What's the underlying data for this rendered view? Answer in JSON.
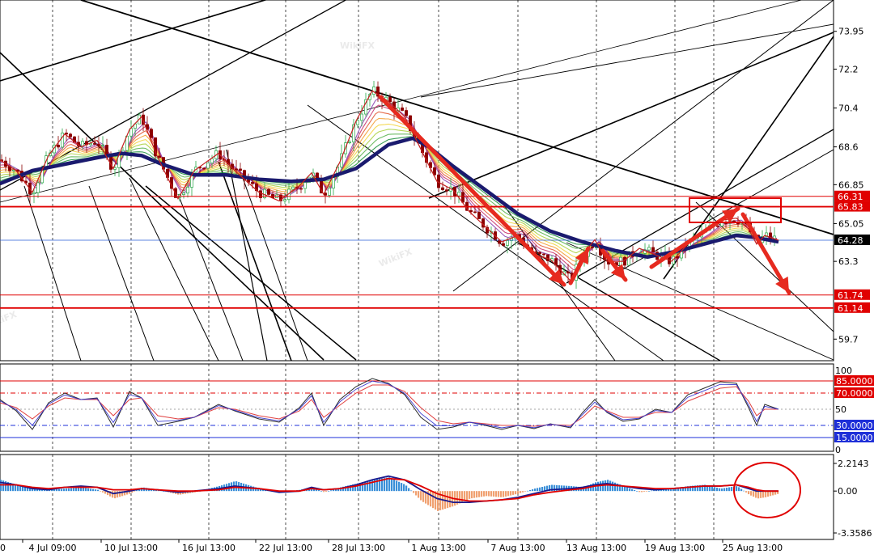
{
  "chart_data": [
    {
      "type": "line",
      "panel": "price",
      "title": "",
      "y_axis_ticks": [
        73.95,
        72.2,
        70.4,
        68.6,
        66.85,
        65.05,
        63.3,
        59.7
      ],
      "ylim": [
        58.7,
        75.4
      ],
      "x_axis_ticks": [
        "4 Jul 09:00",
        "10 Jul 13:00",
        "16 Jul 13:00",
        "22 Jul 13:00",
        "28 Jul 13:00",
        "1 Aug 13:00",
        "7 Aug 13:00",
        "13 Aug 13:00",
        "19 Aug 13:00",
        "25 Aug 13:00"
      ],
      "x_edge_label": "0",
      "current_price": {
        "value": 64.28,
        "label": "64.28",
        "color": "#000000"
      },
      "horizontal_levels": [
        {
          "value": 66.31,
          "label": "66.31",
          "color": "#e00000"
        },
        {
          "value": 65.83,
          "label": "65.83",
          "color": "#e00000"
        },
        {
          "value": 61.74,
          "label": "61.74",
          "color": "#e00000"
        },
        {
          "value": 61.14,
          "label": "61.14",
          "color": "#e00000"
        }
      ],
      "series": [
        {
          "style": "thick-navy-moving-average",
          "color": "#1a1a6e",
          "x": [
            0,
            40,
            80,
            120,
            150,
            175,
            200,
            240,
            280,
            320,
            360,
            400,
            440,
            480,
            510,
            530,
            560,
            600,
            640,
            680,
            720,
            760,
            800,
            840,
            880,
            910,
            935,
            962
          ],
          "y": [
            66.9,
            67.5,
            67.8,
            68.1,
            68.3,
            68.2,
            67.8,
            67.3,
            67.3,
            67.1,
            67.0,
            67.1,
            67.6,
            68.7,
            69.0,
            68.6,
            67.7,
            66.6,
            65.5,
            64.7,
            64.2,
            63.8,
            63.5,
            63.8,
            64.2,
            64.5,
            64.4,
            64.2
          ]
        },
        {
          "style": "price-path",
          "color": "#6b0000",
          "x": [
            0,
            20,
            40,
            60,
            80,
            100,
            120,
            140,
            160,
            175,
            195,
            220,
            240,
            270,
            290,
            320,
            345,
            370,
            385,
            400,
            420,
            440,
            460,
            480,
            500,
            520,
            540,
            560,
            580,
            600,
            620,
            640,
            660,
            680,
            705,
            720,
            735,
            750,
            770,
            790,
            810,
            830,
            850,
            870,
            890,
            910,
            925,
            935,
            945,
            962
          ],
          "y": [
            68.0,
            67.5,
            66.5,
            68.2,
            69.2,
            68.6,
            68.9,
            67.6,
            69.4,
            70.0,
            68.1,
            66.2,
            67.5,
            68.3,
            67.5,
            66.5,
            66.1,
            66.8,
            67.4,
            66.4,
            67.9,
            69.8,
            71.2,
            70.7,
            70.0,
            68.5,
            67.0,
            66.6,
            65.6,
            64.9,
            64.2,
            64.5,
            63.6,
            63.4,
            62.4,
            63.6,
            64.3,
            63.3,
            63.3,
            63.9,
            63.6,
            63.3,
            64.1,
            64.6,
            65.2,
            65.3,
            64.8,
            64.1,
            64.5,
            64.28
          ]
        }
      ]
    },
    {
      "type": "line",
      "panel": "oscillator",
      "y_axis_ticks": [
        100,
        50,
        0
      ],
      "levels": [
        {
          "value": 85,
          "label": "85.0000",
          "color": "#e00000"
        },
        {
          "value": 70,
          "label": "70.0000",
          "color": "#e00000"
        },
        {
          "value": 30,
          "label": "30.0000",
          "color": "#1e2fd8"
        },
        {
          "value": 15,
          "label": "15.0000",
          "color": "#1e2fd8"
        }
      ],
      "series": [
        {
          "style": "fast-line",
          "color": "#2b2b2b",
          "x": [
            0,
            20,
            40,
            60,
            80,
            100,
            120,
            140,
            160,
            175,
            195,
            220,
            240,
            270,
            290,
            320,
            345,
            370,
            385,
            400,
            420,
            440,
            460,
            480,
            500,
            520,
            540,
            560,
            580,
            600,
            620,
            640,
            660,
            680,
            705,
            720,
            735,
            750,
            770,
            790,
            810,
            830,
            850,
            870,
            890,
            910,
            925,
            935,
            945,
            962
          ],
          "y": [
            62,
            48,
            25,
            58,
            70,
            62,
            64,
            28,
            72,
            64,
            30,
            35,
            40,
            56,
            48,
            38,
            34,
            52,
            70,
            30,
            62,
            78,
            88,
            82,
            68,
            40,
            25,
            28,
            34,
            30,
            25,
            30,
            26,
            32,
            27,
            46,
            62,
            46,
            35,
            38,
            50,
            46,
            68,
            76,
            84,
            82,
            52,
            30,
            56,
            50
          ]
        },
        {
          "style": "slow-line",
          "color": "#e04040",
          "x": [
            0,
            20,
            40,
            60,
            80,
            100,
            120,
            140,
            160,
            175,
            195,
            220,
            240,
            270,
            290,
            320,
            345,
            370,
            385,
            400,
            420,
            440,
            460,
            480,
            500,
            520,
            540,
            560,
            580,
            600,
            620,
            640,
            660,
            680,
            705,
            720,
            735,
            750,
            770,
            790,
            810,
            830,
            850,
            870,
            890,
            910,
            925,
            935,
            945,
            962
          ],
          "y": [
            58,
            52,
            38,
            54,
            64,
            62,
            62,
            42,
            62,
            64,
            42,
            38,
            40,
            52,
            50,
            42,
            38,
            48,
            62,
            40,
            55,
            70,
            80,
            80,
            72,
            52,
            36,
            32,
            34,
            32,
            30,
            30,
            29,
            31,
            30,
            40,
            54,
            48,
            40,
            40,
            46,
            46,
            60,
            68,
            76,
            78,
            60,
            42,
            50,
            50
          ]
        }
      ]
    },
    {
      "type": "bar",
      "panel": "histogram",
      "y_axis_ticks": [
        2.2143,
        0.0,
        -3.3586
      ],
      "ylim": [
        -3.3586,
        2.2143
      ],
      "colors": {
        "positive": "#3a8fd8",
        "negative": "#f0a070",
        "signal": "#e00000",
        "macd": "#1a1a8e"
      },
      "x": [
        0,
        20,
        40,
        60,
        80,
        100,
        120,
        140,
        160,
        175,
        195,
        220,
        240,
        270,
        290,
        320,
        345,
        370,
        385,
        400,
        420,
        440,
        460,
        480,
        500,
        520,
        540,
        560,
        580,
        600,
        620,
        640,
        660,
        680,
        705,
        720,
        735,
        750,
        770,
        790,
        810,
        830,
        850,
        870,
        890,
        910,
        925,
        935,
        945,
        962
      ],
      "values": [
        0.9,
        0.5,
        0.2,
        0.1,
        0.2,
        0.3,
        0.1,
        -0.6,
        -0.2,
        0.3,
        0.1,
        -0.3,
        -0.1,
        0.4,
        0.8,
        0.2,
        -0.1,
        0.1,
        0.3,
        -0.1,
        0.3,
        0.6,
        0.9,
        1.1,
        0.5,
        -0.8,
        -1.6,
        -1.2,
        -0.6,
        -0.4,
        -0.5,
        -0.2,
        0.2,
        0.5,
        0.4,
        0.3,
        0.7,
        0.9,
        0.4,
        -0.1,
        0.1,
        0.2,
        0.4,
        0.5,
        0.2,
        0.4,
        -0.3,
        -0.6,
        -0.5,
        -0.2
      ],
      "macd_line": [
        0.7,
        0.5,
        0.2,
        0.1,
        0.3,
        0.4,
        0.3,
        -0.2,
        0.0,
        0.2,
        0.1,
        -0.1,
        0.0,
        0.2,
        0.4,
        0.2,
        -0.1,
        0.0,
        0.3,
        0.1,
        0.2,
        0.5,
        0.9,
        1.2,
        0.9,
        0.1,
        -0.6,
        -0.9,
        -0.9,
        -0.8,
        -0.7,
        -0.5,
        -0.2,
        0.1,
        0.2,
        0.3,
        0.5,
        0.6,
        0.4,
        0.2,
        0.1,
        0.2,
        0.3,
        0.4,
        0.4,
        0.5,
        0.2,
        0.0,
        0.0,
        0.0
      ],
      "signal_line": [
        0.5,
        0.5,
        0.3,
        0.2,
        0.3,
        0.3,
        0.3,
        0.1,
        0.1,
        0.2,
        0.1,
        0.0,
        0.0,
        0.1,
        0.3,
        0.2,
        0.0,
        0.0,
        0.2,
        0.1,
        0.2,
        0.4,
        0.7,
        1.0,
        0.9,
        0.4,
        -0.2,
        -0.6,
        -0.8,
        -0.8,
        -0.7,
        -0.6,
        -0.3,
        -0.1,
        0.1,
        0.2,
        0.4,
        0.5,
        0.4,
        0.3,
        0.2,
        0.2,
        0.3,
        0.4,
        0.4,
        0.5,
        0.3,
        0.1,
        0.0,
        0.0
      ]
    }
  ],
  "annotations": {
    "arrow_color": "#e62a1f",
    "resistance_box_color": "#e00000",
    "circle_color": "#e00000"
  },
  "watermark": "WikiFX"
}
